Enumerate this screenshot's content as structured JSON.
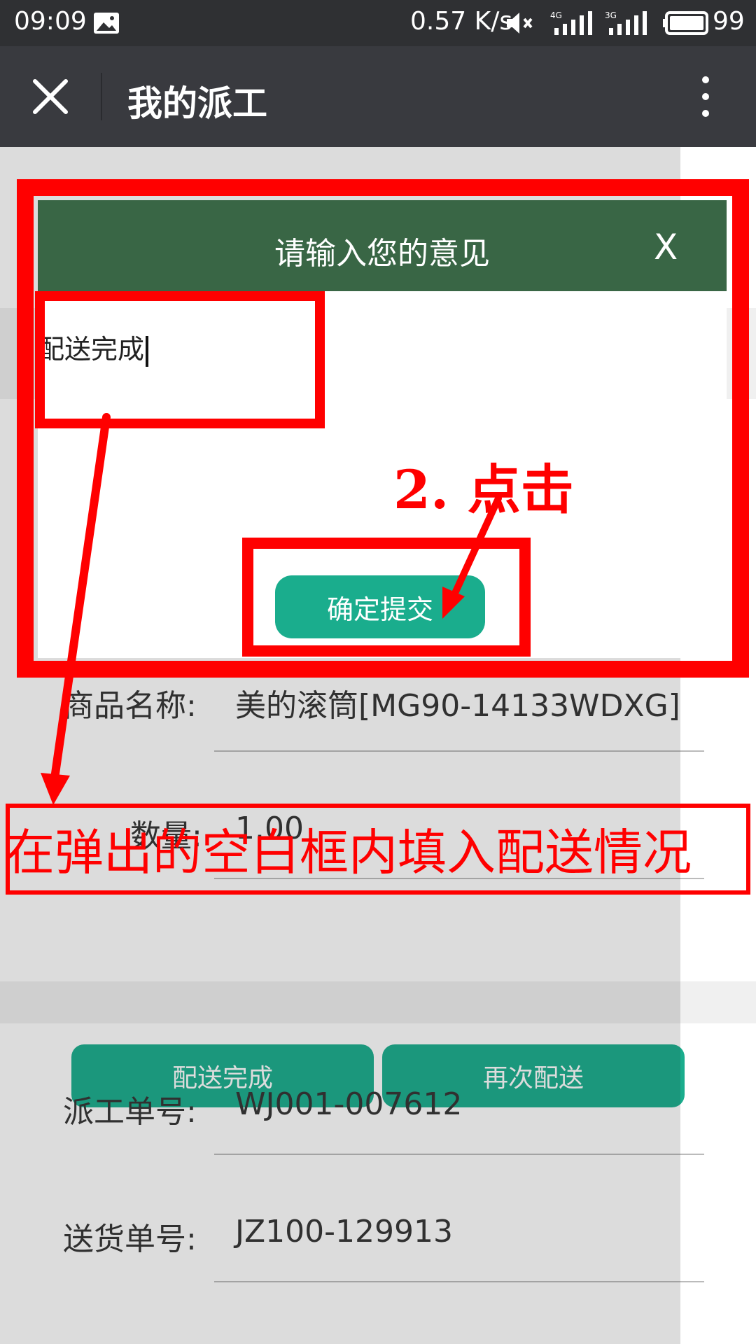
{
  "status_bar": {
    "time": "09:09",
    "net_speed": "0.57 K/s",
    "net_4g": "4G",
    "net_3g": "3G",
    "battery": "99"
  },
  "title_bar": {
    "title": "我的派工",
    "close_icon": "close-icon",
    "more_icon": "more-vertical-icon"
  },
  "modal": {
    "title": "请输入您的意见",
    "close_label": "X",
    "input_value": "配送完成",
    "submit_label": "确定提交"
  },
  "order1": {
    "product_label": "商品名称:",
    "product_value": "美的滚筒[MG90-14133WDXG]",
    "qty_label": "数量:",
    "qty_value": "1.00",
    "btn_complete": "配送完成",
    "btn_redeliver": "再次配送"
  },
  "order2": {
    "dispatch_label": "派工单号:",
    "dispatch_value": "WJ001-007612",
    "delivery_label": "送货单号:",
    "delivery_value": "JZ100-129913"
  },
  "annotations": {
    "step2": "2. 点击",
    "instruction": "在弹出的空白框内填入配送情况"
  },
  "colors": {
    "modal_header": "#396645",
    "button": "#1aad8d",
    "annotation": "#ff0000",
    "title_bar": "#393a3f"
  }
}
